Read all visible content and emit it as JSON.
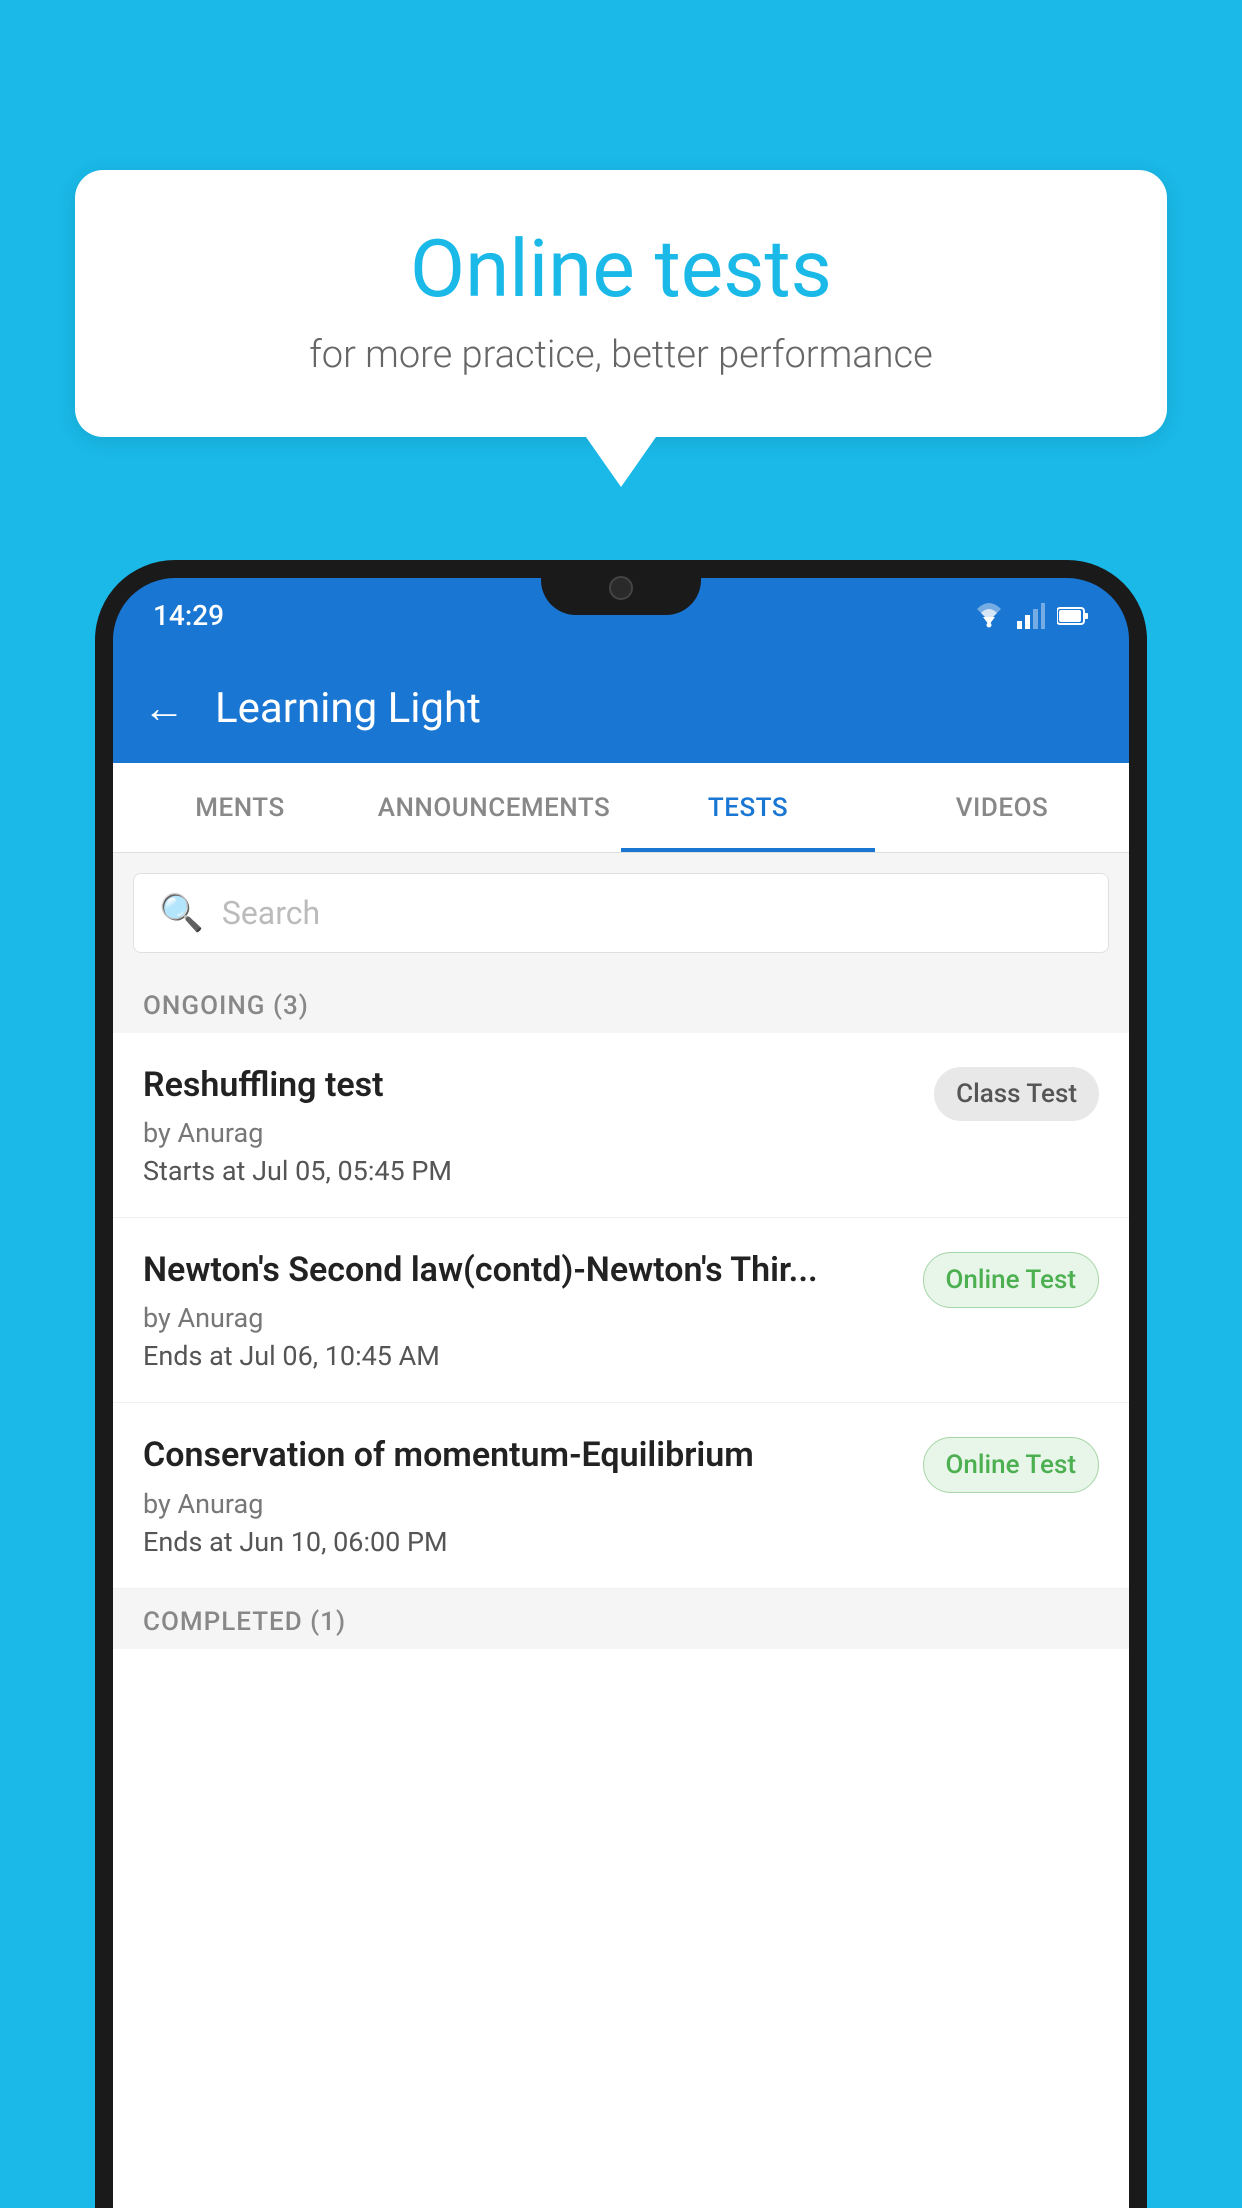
{
  "background": {
    "color": "#1ab9e8"
  },
  "speech_bubble": {
    "title": "Online tests",
    "subtitle": "for more practice, better performance"
  },
  "phone": {
    "status_bar": {
      "time": "14:29"
    },
    "toolbar": {
      "title": "Learning Light",
      "back_label": "←"
    },
    "tabs": [
      {
        "label": "MENTS",
        "active": false
      },
      {
        "label": "ANNOUNCEMENTS",
        "active": false
      },
      {
        "label": "TESTS",
        "active": true
      },
      {
        "label": "VIDEOS",
        "active": false
      }
    ],
    "search": {
      "placeholder": "Search"
    },
    "ongoing_section": {
      "header": "ONGOING (3)"
    },
    "tests": [
      {
        "name": "Reshuffling test",
        "by": "by Anurag",
        "time_label": "Starts at",
        "time": "Jul 05, 05:45 PM",
        "badge": "Class Test",
        "badge_type": "class"
      },
      {
        "name": "Newton's Second law(contd)-Newton's Thir...",
        "by": "by Anurag",
        "time_label": "Ends at",
        "time": "Jul 06, 10:45 AM",
        "badge": "Online Test",
        "badge_type": "online"
      },
      {
        "name": "Conservation of momentum-Equilibrium",
        "by": "by Anurag",
        "time_label": "Ends at",
        "time": "Jun 10, 06:00 PM",
        "badge": "Online Test",
        "badge_type": "online"
      }
    ],
    "completed_section": {
      "header": "COMPLETED (1)"
    }
  }
}
